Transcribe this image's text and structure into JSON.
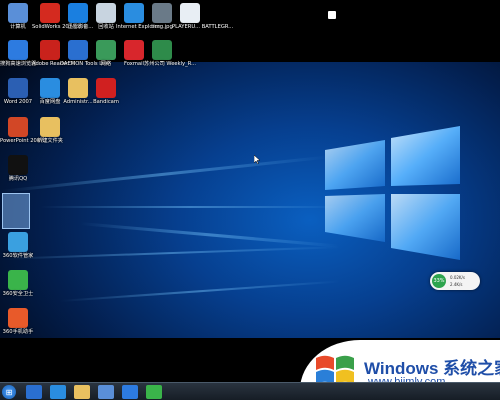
{
  "desktop_icons": [
    {
      "label": "计算机",
      "icon": "computer-icon",
      "color": "#5a8fd8"
    },
    {
      "label": "SolidWorks 2014 x64 ...",
      "icon": "solidworks-icon",
      "color": "#d42a1f"
    },
    {
      "label": "迅雷影音",
      "icon": "xunlei-player-icon",
      "color": "#1a7fe0"
    },
    {
      "label": "回收站",
      "icon": "recycle-bin-icon",
      "color": "#c8d4e0"
    },
    {
      "label": "Internet Explorer",
      "icon": "ie-icon",
      "color": "#2a8de0"
    },
    {
      "label": "timg.jpg",
      "icon": "image-file-icon",
      "color": "#6a7a88"
    },
    {
      "label": "PLAYERU... BATTLEGR...",
      "icon": "document-icon",
      "color": "#e8eef4"
    },
    {
      "label": "搜狗高速浏览器",
      "icon": "sogou-browser-icon",
      "color": "#2d7be0"
    },
    {
      "label": "Adobe Reader XI",
      "icon": "adobe-reader-icon",
      "color": "#c9221c"
    },
    {
      "label": "DAEMON Tools Lite",
      "icon": "daemon-tools-icon",
      "color": "#2a6fd0"
    },
    {
      "label": "网络",
      "icon": "network-icon",
      "color": "#3a9a5a"
    },
    {
      "label": "Foxmail",
      "icon": "foxmail-icon",
      "color": "#d8262c"
    },
    {
      "label": "苏州公司 Weekly_R...",
      "icon": "excel-file-icon",
      "color": "#2e8b4a"
    },
    {
      "label": "Word 2007",
      "icon": "word-icon",
      "color": "#2b5fb3"
    },
    {
      "label": "百度网盘",
      "icon": "baidu-netdisk-icon",
      "color": "#2a8de0"
    },
    {
      "label": "Administr...",
      "icon": "user-folder-icon",
      "color": "#e8c060"
    },
    {
      "label": "Bandicam",
      "icon": "bandicam-icon",
      "color": "#d02020"
    },
    {
      "label": "PowerPoint 2007",
      "icon": "powerpoint-icon",
      "color": "#d24726"
    },
    {
      "label": "新建文件夹",
      "icon": "folder-icon",
      "color": "#e8c060"
    },
    {
      "label": "腾讯QQ",
      "icon": "qq-icon",
      "color": "#111111"
    },
    {
      "label": "360软件管家",
      "icon": "360-software-icon",
      "color": "#3aa0e0"
    },
    {
      "label": "360安全卫士",
      "icon": "360-security-icon",
      "color": "#3ab44a"
    },
    {
      "label": "360手机助手",
      "icon": "360-mobile-icon",
      "color": "#e85a2a"
    }
  ],
  "speed_widget": {
    "percent": "33%",
    "upload": "0.02K/s",
    "download": "2.4K/s"
  },
  "watermark": {
    "title": "Windows 系统之家",
    "url": "www.bjjmlv.com"
  },
  "taskbar": {
    "start_label": "⊞",
    "items": [
      "360",
      "IE",
      "folder",
      "explorer",
      "sogou",
      "360browser"
    ]
  },
  "colors": {
    "accent": "#1f4ea8",
    "glow": "#4aa8ff"
  }
}
